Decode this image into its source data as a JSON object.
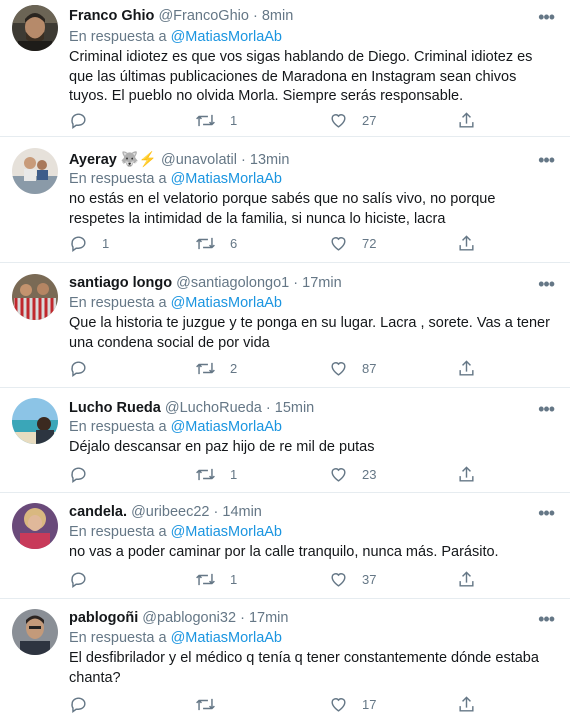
{
  "reply_prefix": "En respuesta a",
  "more_glyph": "•••",
  "tweets": [
    {
      "name": "Franco Ghio",
      "emoji": "",
      "handle": "@FrancoGhio",
      "time": "8min",
      "mention": "@MatiasMorlaAb",
      "text": "Criminal idiotez es que vos sigas hablando de Diego. Criminal idiotez es que las últimas publicaciones de Maradona en Instagram sean chivos tuyos. El pueblo no olvida Morla. Siempre serás responsable.",
      "replies": "",
      "retweets": "1",
      "likes": "27"
    },
    {
      "name": "Ayeray",
      "emoji": "🐺⚡",
      "handle": "@unavolatil",
      "time": "13min",
      "mention": "@MatiasMorlaAb",
      "text": "no estás en el velatorio porque sabés que no salís vivo, no porque respetes la intimidad de la familia, si nunca lo hiciste, lacra",
      "replies": "1",
      "retweets": "6",
      "likes": "72"
    },
    {
      "name": "santiago longo",
      "emoji": "",
      "handle": "@santiagolongo1",
      "time": "17min",
      "mention": "@MatiasMorlaAb",
      "text": "Que la historia te juzgue y te ponga en su lugar. Lacra , sorete. Vas a tener una condena social de por vida",
      "replies": "",
      "retweets": "2",
      "likes": "87"
    },
    {
      "name": "Lucho Rueda",
      "emoji": "",
      "handle": "@LuchoRueda",
      "time": "15min",
      "mention": "@MatiasMorlaAb",
      "text": "Déjalo descansar en paz hijo de re mil  de putas",
      "replies": "",
      "retweets": "1",
      "likes": "23"
    },
    {
      "name": "candela.",
      "emoji": "",
      "handle": "@uribeec22",
      "time": "14min",
      "mention": "@MatiasMorlaAb",
      "text": "no vas a poder caminar por la calle tranquilo, nunca más. Parásito.",
      "replies": "",
      "retweets": "1",
      "likes": "37"
    },
    {
      "name": "pablogoñi",
      "emoji": "",
      "handle": "@pablogoni32",
      "time": "17min",
      "mention": "@MatiasMorlaAb",
      "text": "El desfibrilador y el médico q tenía q tener constantemente dónde estaba chanta?",
      "replies": "",
      "retweets": "",
      "likes": "17"
    }
  ]
}
